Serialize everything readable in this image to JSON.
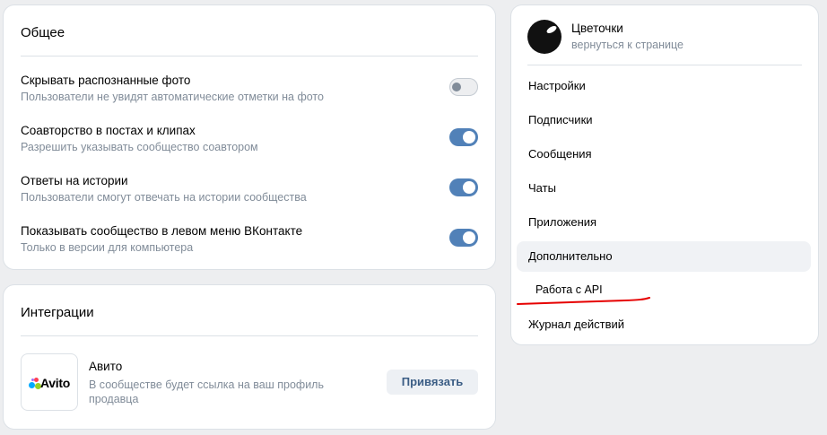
{
  "general": {
    "title": "Общее",
    "settings": [
      {
        "title": "Скрывать распознанные фото",
        "desc": "Пользователи не увидят автоматические отметки на фото",
        "enabled": false
      },
      {
        "title": "Соавторство в постах и клипах",
        "desc": "Разрешить указывать сообщество соавтором",
        "enabled": true
      },
      {
        "title": "Ответы на истории",
        "desc": "Пользователи смогут отвечать на истории сообщества",
        "enabled": true
      },
      {
        "title": "Показывать сообщество в левом меню ВКонтакте",
        "desc": "Только в версии для компьютера",
        "enabled": true
      }
    ]
  },
  "integrations": {
    "title": "Интеграции",
    "item": {
      "logo_text": "Avito",
      "name": "Авито",
      "desc": "В сообществе будет ссылка на ваш профиль продавца",
      "button": "Привязать"
    }
  },
  "nav": {
    "group_name": "Цветочки",
    "back_link": "вернуться к странице",
    "items": [
      {
        "label": "Настройки"
      },
      {
        "label": "Подписчики"
      },
      {
        "label": "Сообщения"
      },
      {
        "label": "Чаты"
      },
      {
        "label": "Приложения"
      },
      {
        "label": "Дополнительно"
      },
      {
        "label": "Работа с API"
      },
      {
        "label": "Журнал действий"
      }
    ]
  },
  "colors": {
    "accent": "#5181b8",
    "background": "#edeef0",
    "secondary_text": "#818c99",
    "annotation": "#e60000"
  }
}
